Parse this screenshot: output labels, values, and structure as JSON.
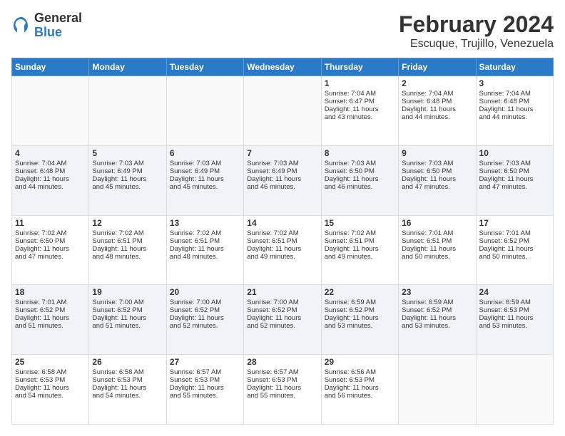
{
  "header": {
    "logo_general": "General",
    "logo_blue": "Blue",
    "title": "February 2024",
    "subtitle": "Escuque, Trujillo, Venezuela"
  },
  "days_header": [
    "Sunday",
    "Monday",
    "Tuesday",
    "Wednesday",
    "Thursday",
    "Friday",
    "Saturday"
  ],
  "weeks": [
    [
      {
        "day": "",
        "info": ""
      },
      {
        "day": "",
        "info": ""
      },
      {
        "day": "",
        "info": ""
      },
      {
        "day": "",
        "info": ""
      },
      {
        "day": "1",
        "info": "Sunrise: 7:04 AM\nSunset: 6:47 PM\nDaylight: 11 hours\nand 43 minutes."
      },
      {
        "day": "2",
        "info": "Sunrise: 7:04 AM\nSunset: 6:48 PM\nDaylight: 11 hours\nand 44 minutes."
      },
      {
        "day": "3",
        "info": "Sunrise: 7:04 AM\nSunset: 6:48 PM\nDaylight: 11 hours\nand 44 minutes."
      }
    ],
    [
      {
        "day": "4",
        "info": "Sunrise: 7:04 AM\nSunset: 6:48 PM\nDaylight: 11 hours\nand 44 minutes."
      },
      {
        "day": "5",
        "info": "Sunrise: 7:03 AM\nSunset: 6:49 PM\nDaylight: 11 hours\nand 45 minutes."
      },
      {
        "day": "6",
        "info": "Sunrise: 7:03 AM\nSunset: 6:49 PM\nDaylight: 11 hours\nand 45 minutes."
      },
      {
        "day": "7",
        "info": "Sunrise: 7:03 AM\nSunset: 6:49 PM\nDaylight: 11 hours\nand 46 minutes."
      },
      {
        "day": "8",
        "info": "Sunrise: 7:03 AM\nSunset: 6:50 PM\nDaylight: 11 hours\nand 46 minutes."
      },
      {
        "day": "9",
        "info": "Sunrise: 7:03 AM\nSunset: 6:50 PM\nDaylight: 11 hours\nand 47 minutes."
      },
      {
        "day": "10",
        "info": "Sunrise: 7:03 AM\nSunset: 6:50 PM\nDaylight: 11 hours\nand 47 minutes."
      }
    ],
    [
      {
        "day": "11",
        "info": "Sunrise: 7:02 AM\nSunset: 6:50 PM\nDaylight: 11 hours\nand 47 minutes."
      },
      {
        "day": "12",
        "info": "Sunrise: 7:02 AM\nSunset: 6:51 PM\nDaylight: 11 hours\nand 48 minutes."
      },
      {
        "day": "13",
        "info": "Sunrise: 7:02 AM\nSunset: 6:51 PM\nDaylight: 11 hours\nand 48 minutes."
      },
      {
        "day": "14",
        "info": "Sunrise: 7:02 AM\nSunset: 6:51 PM\nDaylight: 11 hours\nand 49 minutes."
      },
      {
        "day": "15",
        "info": "Sunrise: 7:02 AM\nSunset: 6:51 PM\nDaylight: 11 hours\nand 49 minutes."
      },
      {
        "day": "16",
        "info": "Sunrise: 7:01 AM\nSunset: 6:51 PM\nDaylight: 11 hours\nand 50 minutes."
      },
      {
        "day": "17",
        "info": "Sunrise: 7:01 AM\nSunset: 6:52 PM\nDaylight: 11 hours\nand 50 minutes."
      }
    ],
    [
      {
        "day": "18",
        "info": "Sunrise: 7:01 AM\nSunset: 6:52 PM\nDaylight: 11 hours\nand 51 minutes."
      },
      {
        "day": "19",
        "info": "Sunrise: 7:00 AM\nSunset: 6:52 PM\nDaylight: 11 hours\nand 51 minutes."
      },
      {
        "day": "20",
        "info": "Sunrise: 7:00 AM\nSunset: 6:52 PM\nDaylight: 11 hours\nand 52 minutes."
      },
      {
        "day": "21",
        "info": "Sunrise: 7:00 AM\nSunset: 6:52 PM\nDaylight: 11 hours\nand 52 minutes."
      },
      {
        "day": "22",
        "info": "Sunrise: 6:59 AM\nSunset: 6:52 PM\nDaylight: 11 hours\nand 53 minutes."
      },
      {
        "day": "23",
        "info": "Sunrise: 6:59 AM\nSunset: 6:52 PM\nDaylight: 11 hours\nand 53 minutes."
      },
      {
        "day": "24",
        "info": "Sunrise: 6:59 AM\nSunset: 6:53 PM\nDaylight: 11 hours\nand 53 minutes."
      }
    ],
    [
      {
        "day": "25",
        "info": "Sunrise: 6:58 AM\nSunset: 6:53 PM\nDaylight: 11 hours\nand 54 minutes."
      },
      {
        "day": "26",
        "info": "Sunrise: 6:58 AM\nSunset: 6:53 PM\nDaylight: 11 hours\nand 54 minutes."
      },
      {
        "day": "27",
        "info": "Sunrise: 6:57 AM\nSunset: 6:53 PM\nDaylight: 11 hours\nand 55 minutes."
      },
      {
        "day": "28",
        "info": "Sunrise: 6:57 AM\nSunset: 6:53 PM\nDaylight: 11 hours\nand 55 minutes."
      },
      {
        "day": "29",
        "info": "Sunrise: 6:56 AM\nSunset: 6:53 PM\nDaylight: 11 hours\nand 56 minutes."
      },
      {
        "day": "",
        "info": ""
      },
      {
        "day": "",
        "info": ""
      }
    ]
  ]
}
